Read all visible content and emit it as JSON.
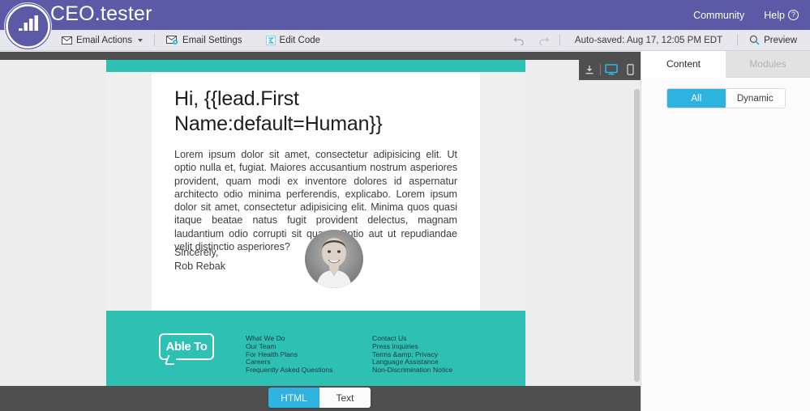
{
  "app": {
    "logo_icon": "marketo-bars-circle-icon",
    "title": "CEO.tester",
    "community_label": "Community",
    "help_label": "Help",
    "help_icon": "question-circle-icon",
    "brand_purple": "#5c5aa7"
  },
  "toolbar": {
    "email_actions": {
      "label": "Email Actions",
      "icon": "envelope-icon",
      "caret": "caret-down-icon"
    },
    "email_settings": {
      "label": "Email Settings",
      "icon": "envelope-gear-icon"
    },
    "edit_code": {
      "label": "Edit Code",
      "icon": "code-brackets-icon"
    },
    "undo_icon": "undo-arrow-icon",
    "redo_icon": "redo-arrow-icon",
    "autosave_text": "Auto-saved: Aug 17, 12:05 PM EDT",
    "preview": {
      "label": "Preview",
      "icon": "magnifier-icon"
    }
  },
  "device_bar": {
    "download_icon": "download-bottom-icon",
    "desktop_icon": "desktop-monitor-icon",
    "mobile_icon": "mobile-phone-icon",
    "active": "desktop"
  },
  "email": {
    "band_color": "#2ec0b2",
    "heading": "Hi, {{lead.First Name:default=Human}}",
    "paragraph": "Lorem ipsum dolor sit amet, consectetur adipisicing elit. Ut optio nulla et, fugiat. Maiores accusantium nostrum asperiores provident, quam modi ex inventore dolores id aspernatur architecto odio minima perferendis, explicabo. Lorem ipsum dolor sit amet, consectetur adipisicing elit. Minima quos quasi itaque beatae natus fugit provident delectus, magnam laudantium odio corrupti sit quam. Optio aut ut repudiandae velit distinctio asperiores?",
    "signoff": "Sincerely,",
    "signer": "Rob Rebak",
    "headshot_alt": "portrait-photo",
    "footer": {
      "logo_text": "Able To",
      "columns": [
        [
          "What We Do",
          "Our Team",
          "For Health Plans",
          "Careers",
          "Frequently Asked Questions"
        ],
        [
          "Contact Us",
          "Press Inquiries",
          "Terms &amp; Privacy",
          "Language Assistance",
          "Non-Discrimination Notice"
        ]
      ]
    }
  },
  "format_toggle": {
    "html_label": "HTML",
    "text_label": "Text",
    "active": "HTML",
    "active_color": "#2eb3e0"
  },
  "right_panel": {
    "tabs": [
      {
        "label": "Content",
        "state": "active"
      },
      {
        "label": "Modules",
        "state": "disabled"
      }
    ],
    "filter": {
      "all_label": "All",
      "dynamic_label": "Dynamic",
      "active": "All",
      "active_color": "#2eb3e0"
    }
  }
}
